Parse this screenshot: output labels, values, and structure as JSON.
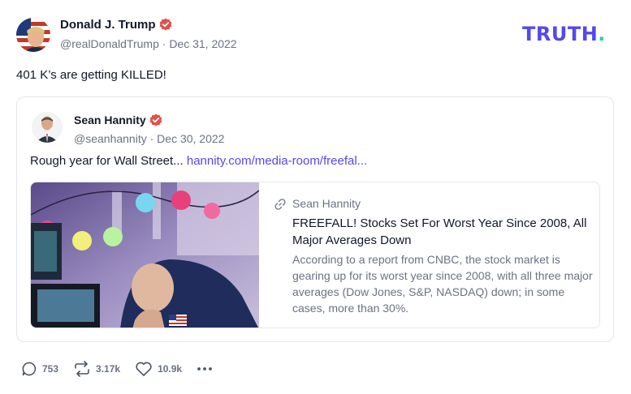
{
  "post": {
    "author": {
      "name": "Donald J. Trump",
      "handle": "@realDonaldTrump",
      "date": "Dec 31, 2022",
      "verified_icon": "verified-badge-icon"
    },
    "brand": {
      "logo_text": "TRUTH",
      "logo_dot": "."
    },
    "text": "401 K’s are getting KILLED!",
    "quote": {
      "author": {
        "name": "Sean Hannity",
        "handle": "@seanhannity",
        "date": "Dec 30, 2022"
      },
      "text": "Rough year for Wall Street...",
      "link_text": "hannity.com/media-room/freefal...",
      "card": {
        "source": "Sean Hannity",
        "title": "FREEFALL! Stocks Set For Worst Year Since 2008, All Major Averages Down",
        "description": "According to a report from CNBC, the stock market is gearing up for its worst year since 2008, with all three major averages (Dow Jones, S&P, NASDAQ) down; in some cases, more than 30%."
      }
    },
    "actions": {
      "replies": "753",
      "retruths": "3.17k",
      "likes": "10.9k"
    }
  },
  "colors": {
    "accent": "#5448ee",
    "verified": "#e2504a",
    "brand_dot": "#1dd3b0",
    "muted_text": "#6b7280"
  }
}
